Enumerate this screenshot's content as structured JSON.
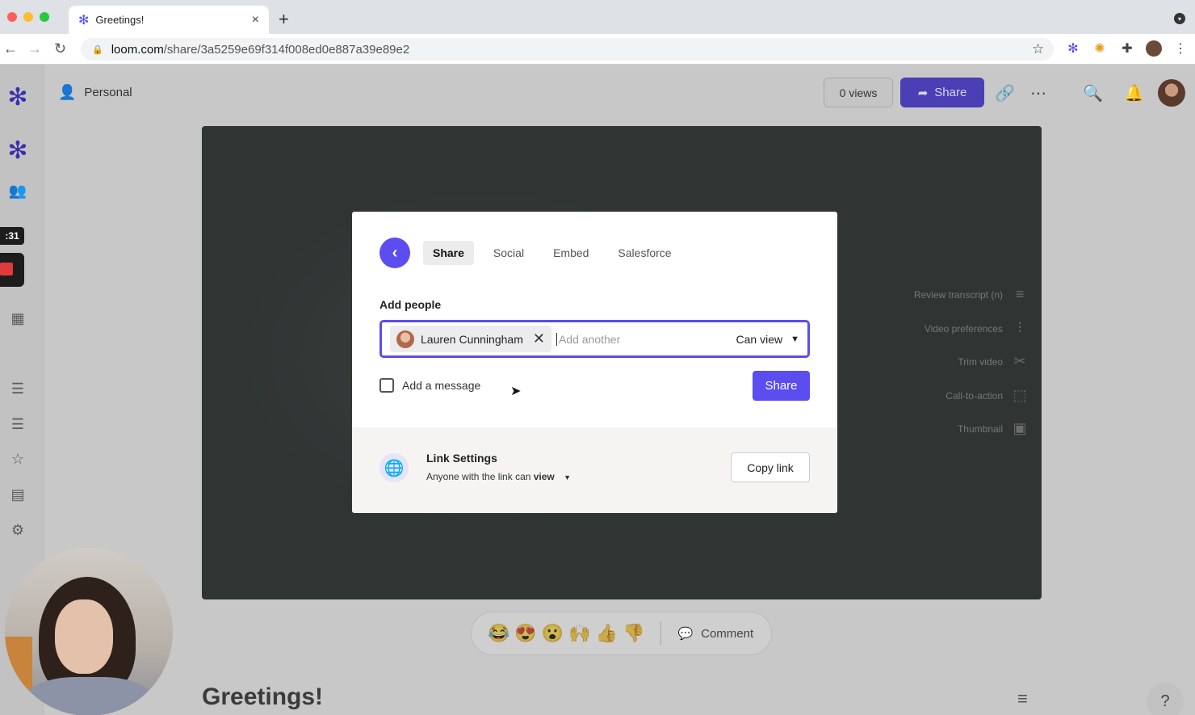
{
  "browser": {
    "tab_title": "Greetings!",
    "tab_close": "×",
    "new_tab": "+",
    "url_domain": "loom.com",
    "url_path": "/share/3a5259e69f314f008ed0e887a39e89e2"
  },
  "header": {
    "workspace": "Personal",
    "views": "0 views",
    "share_label": "Share"
  },
  "sidebar": {
    "timer": ":31"
  },
  "modal": {
    "tabs": [
      {
        "label": "Share"
      },
      {
        "label": "Social"
      },
      {
        "label": "Embed"
      },
      {
        "label": "Salesforce"
      }
    ],
    "add_people_label": "Add people",
    "chip_name": "Lauren Cunningham",
    "add_placeholder": "Add another",
    "permission": "Can view",
    "add_message_label": "Add a message",
    "share_button": "Share",
    "link_settings_title": "Link Settings",
    "link_settings_prefix": "Anyone with the link can ",
    "link_settings_bold": "view",
    "copy_link": "Copy link"
  },
  "side_options": [
    {
      "label": "Review transcript (n)"
    },
    {
      "label": "Video preferences"
    },
    {
      "label": "Trim video"
    },
    {
      "label": "Call-to-action"
    },
    {
      "label": "Thumbnail"
    }
  ],
  "reactions": {
    "emojis": [
      "😂",
      "😍",
      "😮",
      "🙌",
      "👍",
      "👎"
    ],
    "comment_label": "Comment"
  },
  "video_title": "Greetings!",
  "help": "?",
  "colors": {
    "accent": "#5b4df0",
    "accent_dimmed": "#4a3fb4",
    "video_bg": "#303534"
  }
}
